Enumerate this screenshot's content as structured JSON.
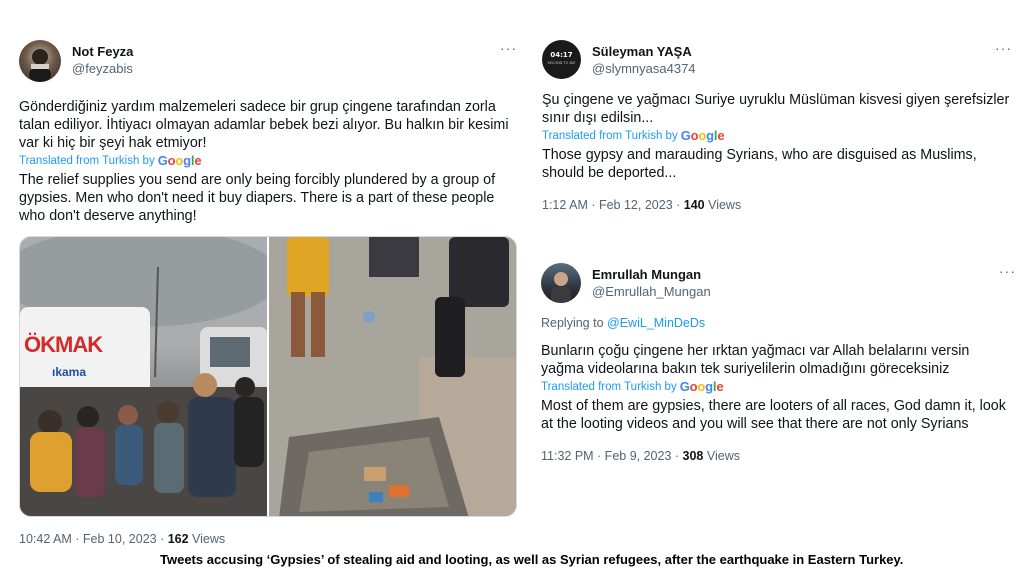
{
  "tweet1": {
    "display_name": "Not Feyza",
    "handle": "@feyzabis",
    "more": "···",
    "original_text": "Gönderdiğiniz yardım malzemeleri sadece bir grup çingene tarafından zorla talan ediliyor. İhtiyacı olmayan adamlar bebek bezi alıyor. Bu halkın bir kesimi var ki hiç bir şeyi hak etmiyor!",
    "translated_label": "Translated from Turkish by",
    "translated_text": "The relief supplies you send are only being forcibly plundered by a group of gypsies. Men who don't need it buy diapers. There is a part of these people who don't deserve anything!",
    "timestamp": "10:42 AM · Feb 10, 2023 · ",
    "views_count": "162",
    "views_label": " Views"
  },
  "tweet2": {
    "display_name": "Süleyman YAŞA",
    "handle": "@slymnyasa4374",
    "more": "···",
    "original_text": "Şu çingene ve yağmacı Suriye uyruklu Müslüman kisvesi giyen şerefsizler sınır dışı edilsin...",
    "translated_label": "Translated from Turkish by",
    "translated_text": "Those gypsy and marauding Syrians, who are disguised as Muslims, should be deported...",
    "timestamp": "1:12 AM · Feb 12, 2023 · ",
    "views_count": "140",
    "views_label": " Views",
    "avatar_text_top": "04:17",
    "avatar_text_bottom": "SECOND TO DIE"
  },
  "tweet3": {
    "display_name": "Emrullah Mungan",
    "handle": "@Emrullah_Mungan",
    "more": "···",
    "replying_label": "Replying to ",
    "replying_handle": "@EwiL_MinDeDs",
    "original_text": "Bunların çoğu çingene her ırktan yağmacı var Allah belalarını versin yağma videolarına bakın tek suriyelilerin olmadığını göreceksiniz",
    "translated_label": "Translated from Turkish by",
    "translated_text": "Most of them are gypsies, there are looters of all races, God damn it, look at the looting videos and you will see that there are not only Syrians",
    "timestamp": "11:32 PM · Feb 9, 2023 · ",
    "views_count": "308",
    "views_label": " Views"
  },
  "photo_left_signs": {
    "sign1": "ÖKMAK",
    "sign2": "ıkama"
  },
  "google_letters": [
    "G",
    "o",
    "o",
    "g",
    "l",
    "e"
  ],
  "caption": "Tweets accusing ‘Gypsies’ of stealing aid and looting, as well as Syrian refugees, after the earthquake in Eastern Turkey.",
  "colors": {
    "link_blue": "#1d9bf0",
    "secondary_gray": "#536471",
    "text": "#0f1419"
  }
}
